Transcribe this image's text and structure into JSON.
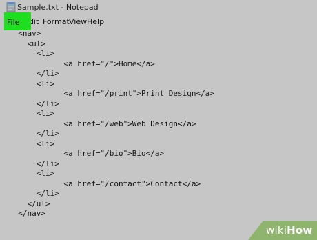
{
  "window": {
    "title": "Sample.txt - Notepad",
    "app_icon": "notepad-icon"
  },
  "menu": {
    "items": [
      "File",
      "Edit",
      "Format",
      "View",
      "Help"
    ],
    "highlighted": "File",
    "highlight_color": "#1fde1f"
  },
  "editor": {
    "lines": [
      "  <nav>",
      "    <ul>",
      "      <li>",
      "            <a href=\"/\">Home</a>",
      "      </li>",
      "      <li>",
      "            <a href=\"/print\">Print Design</a>",
      "      </li>",
      "      <li>",
      "            <a href=\"/web\">Web Design</a>",
      "      </li>",
      "      <li>",
      "            <a href=\"/bio\">Bio</a>",
      "      </li>",
      "      <li>",
      "            <a href=\"/contact\">Contact</a>",
      "      </li>",
      "    </ul>",
      "  </nav>"
    ]
  },
  "watermark": {
    "prefix": "wiki",
    "suffix": "How",
    "color": "#8fb46d"
  }
}
